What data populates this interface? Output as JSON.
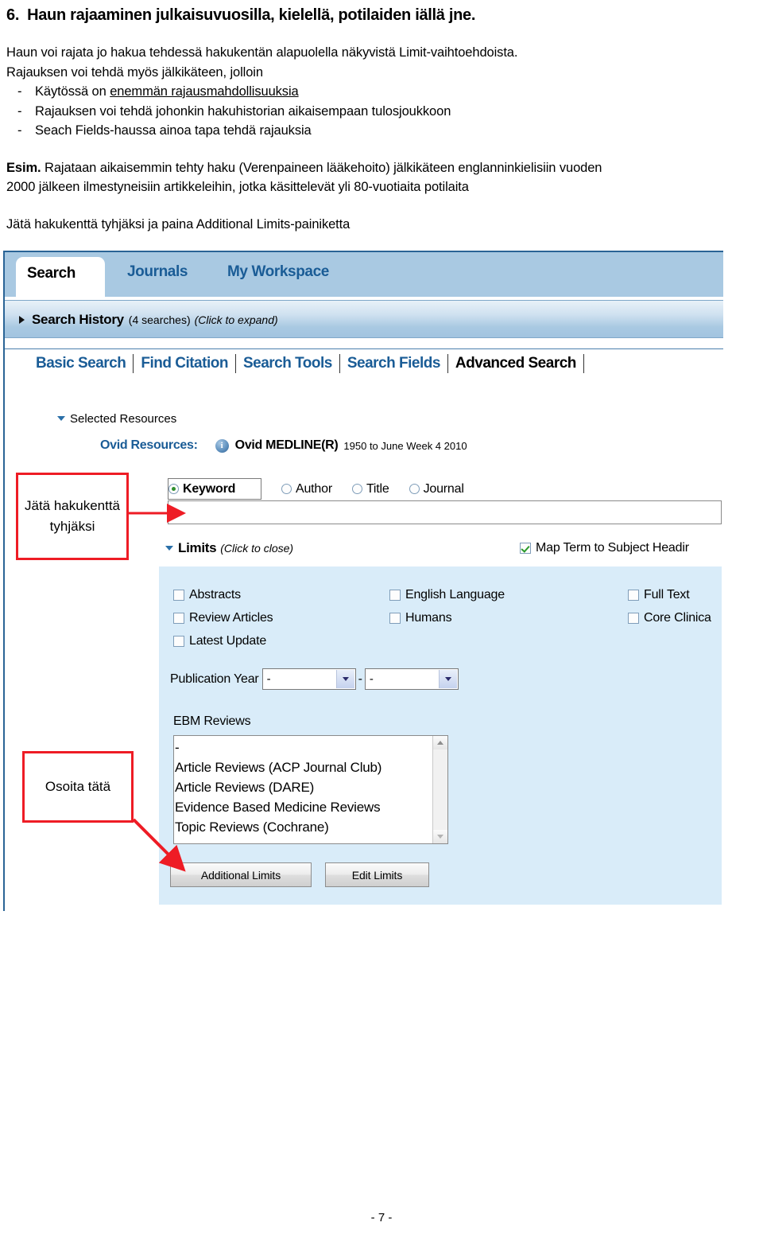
{
  "document": {
    "title_number": "6.",
    "title_text": "Haun rajaaminen julkaisuvuosilla, kielellä, potilaiden iällä jne.",
    "para1": "Haun voi rajata jo hakua tehdessä hakukentän alapuolella näkyvistä Limit-vaihtoehdoista.",
    "para2": "Rajauksen voi tehdä myös jälkikäteen, jolloin",
    "bullets": [
      {
        "dash": "-",
        "pre": "Käytössä on ",
        "underlined": "enemmän rajausmahdollisuuksia",
        "post": ""
      },
      {
        "dash": "-",
        "pre": "Rajauksen voi tehdä johonkin hakuhistorian aikaisempaan tulosjoukkoon",
        "underlined": "",
        "post": ""
      },
      {
        "dash": "-",
        "pre": "Seach Fields-haussa ainoa tapa tehdä rajauksia",
        "underlined": "",
        "post": ""
      }
    ],
    "esim_label": "Esim.",
    "esim_line1": " Rajataan aikaisemmin tehty haku (Verenpaineen lääkehoito) jälkikäteen englanninkielisiin vuoden",
    "esim_line2": "2000 jälkeen ilmestyneisiin artikkeleihin, jotka käsittelevät yli 80-vuotiaita potilaita",
    "instruction": "Jätä hakukenttä tyhjäksi ja paina Additional Limits-painiketta",
    "page_number": "- 7 -"
  },
  "screenshot": {
    "tabs": [
      {
        "label": "Search",
        "active": true
      },
      {
        "label": "Journals",
        "active": false
      },
      {
        "label": "My Workspace",
        "active": false
      }
    ],
    "search_history": {
      "title": "Search History",
      "count": "(4 searches)",
      "hint": "(Click to expand)"
    },
    "subnav": [
      {
        "label": "Basic Search",
        "current": false
      },
      {
        "label": "Find Citation",
        "current": false
      },
      {
        "label": "Search Tools",
        "current": false
      },
      {
        "label": "Search Fields",
        "current": false
      },
      {
        "label": "Advanced Search",
        "current": true
      }
    ],
    "selected_resources_label": "Selected Resources",
    "ovid": {
      "label": "Ovid Resources:",
      "info_glyph": "i",
      "database": "Ovid MEDLINE(R)",
      "range": "1950 to June Week 4 2010"
    },
    "search_modes": [
      {
        "label": "Keyword",
        "selected": true
      },
      {
        "label": "Author",
        "selected": false
      },
      {
        "label": "Title",
        "selected": false
      },
      {
        "label": "Journal",
        "selected": false
      }
    ],
    "search_input_value": "",
    "search_input_placeholder": "",
    "limits": {
      "title": "Limits",
      "hint": "(Click to close)",
      "map_term": {
        "label": "Map Term to Subject Headir",
        "checked": true
      },
      "checkboxes_col1": [
        {
          "label": "Abstracts",
          "checked": false
        },
        {
          "label": "Review Articles",
          "checked": false
        },
        {
          "label": "Latest Update",
          "checked": false
        }
      ],
      "checkboxes_col2": [
        {
          "label": "English Language",
          "checked": false
        },
        {
          "label": "Humans",
          "checked": false
        }
      ],
      "checkboxes_col3": [
        {
          "label": "Full Text",
          "checked": false
        },
        {
          "label": "Core Clinica",
          "checked": false
        }
      ],
      "publication_year": {
        "label": "Publication Year",
        "from_value": "-",
        "to_value": "-",
        "separator": "-"
      },
      "ebm": {
        "label": "EBM Reviews",
        "options": [
          "-",
          "Article Reviews (ACP Journal Club)",
          "Article Reviews (DARE)",
          "Evidence Based Medicine Reviews",
          "Topic Reviews (Cochrane)"
        ]
      },
      "buttons": {
        "additional_limits": "Additional Limits",
        "edit_limits": "Edit Limits"
      }
    }
  },
  "annotations": [
    {
      "text": "Jätä hakukenttä tyhjäksi"
    },
    {
      "text": "Osoita tätä"
    }
  ],
  "colors": {
    "annotation_red": "#ee1c25",
    "tab_blue": "#a9c9e2",
    "link_blue": "#1a5c96",
    "panel_blue": "#d9ecf9"
  }
}
